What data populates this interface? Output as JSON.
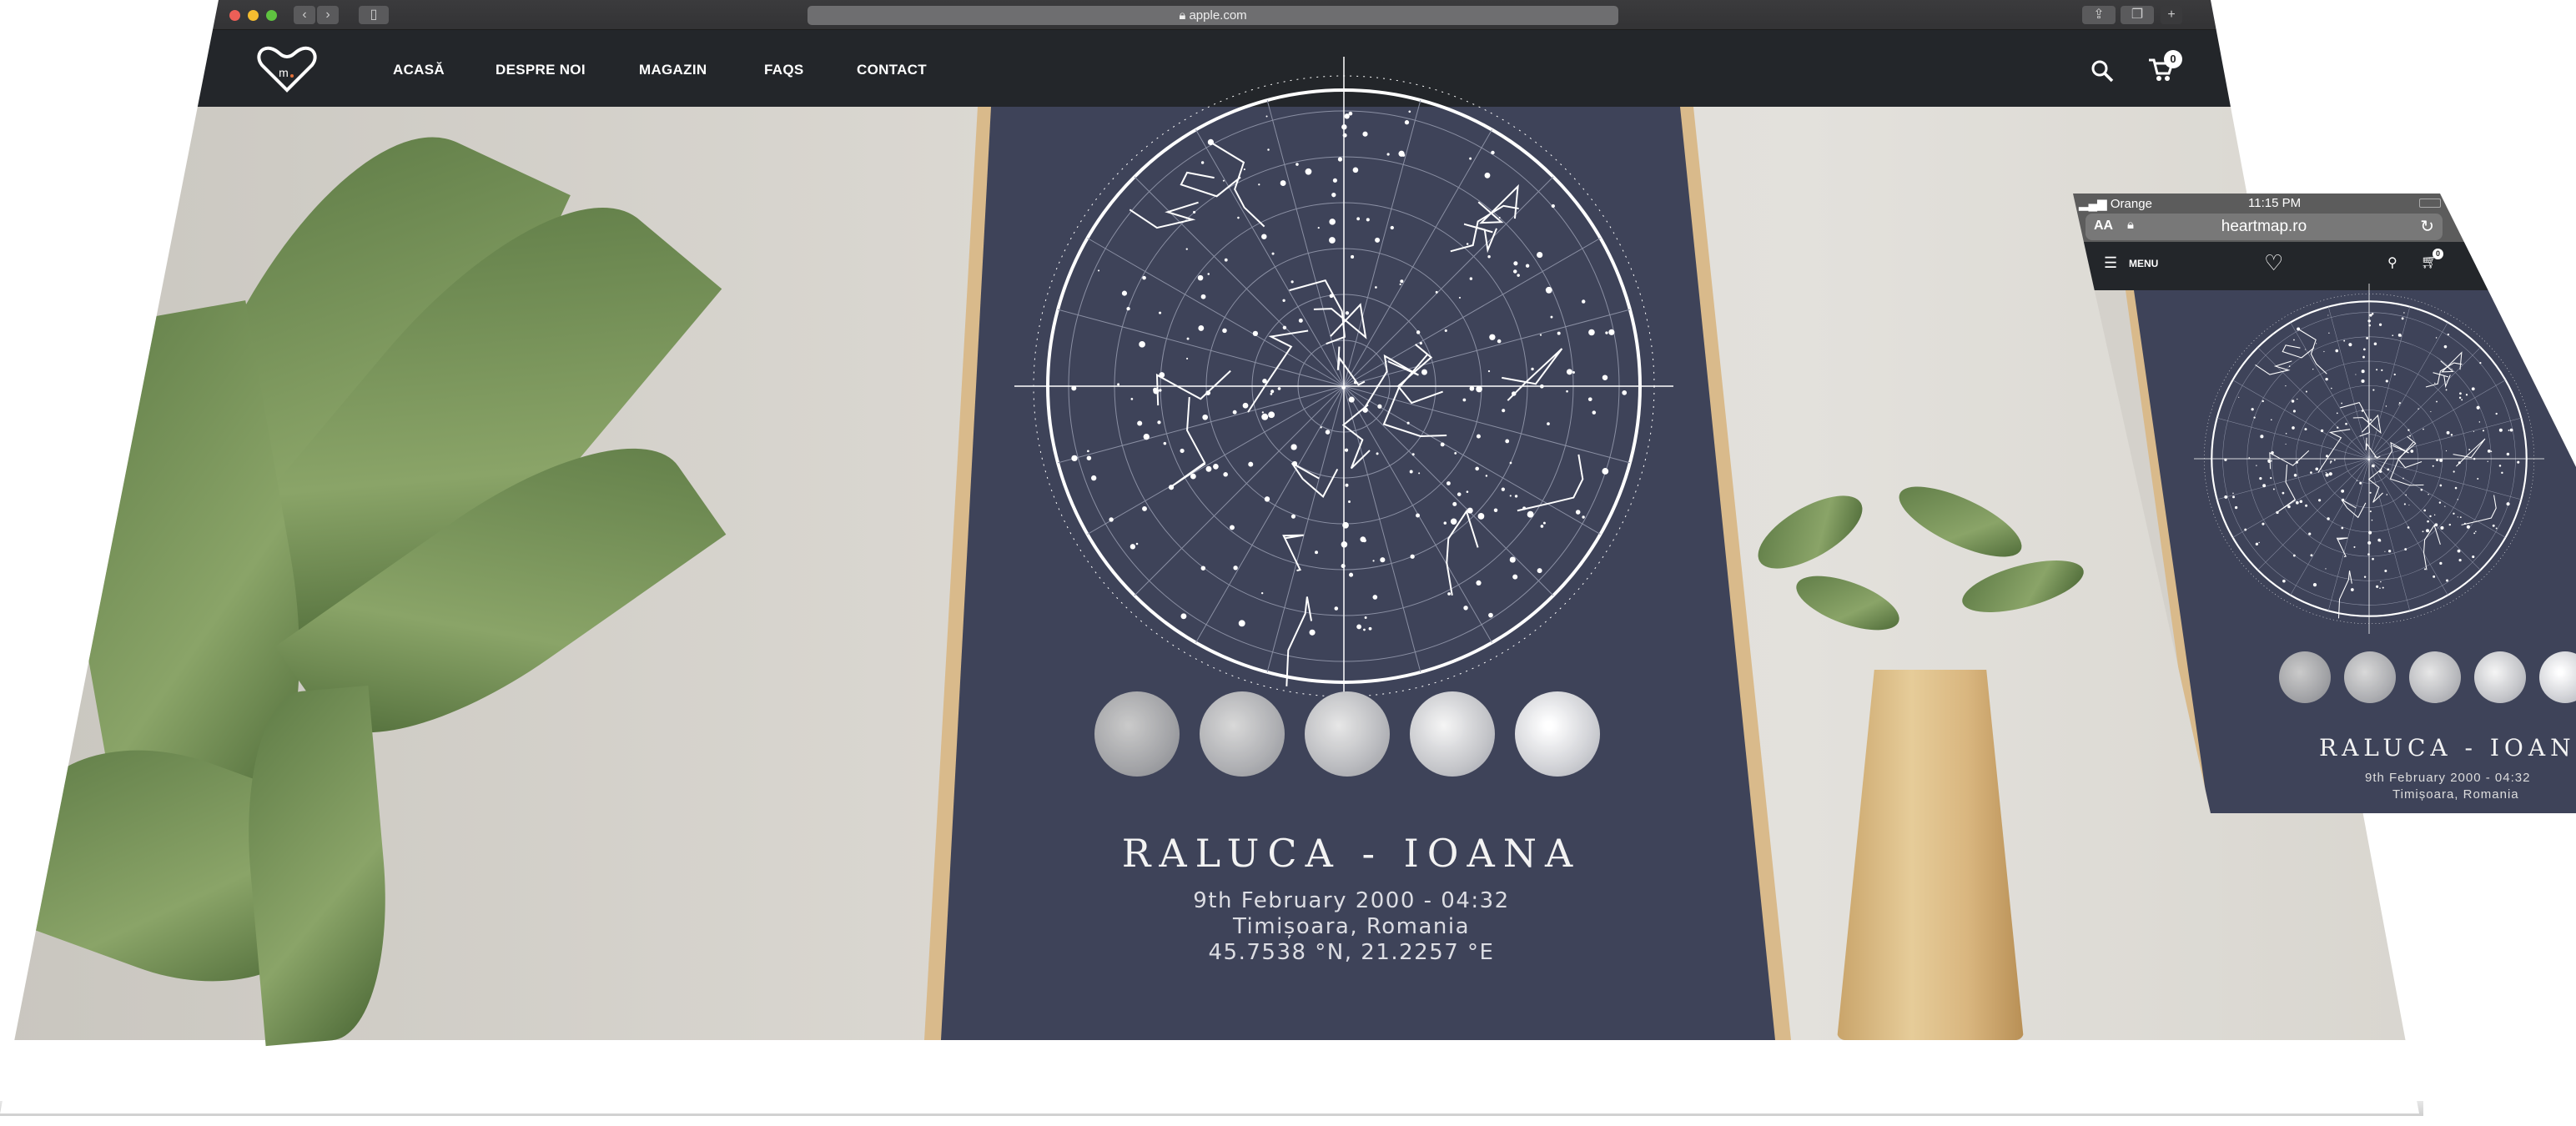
{
  "browser": {
    "url": "apple.com",
    "buttons": {
      "back": "‹",
      "forward": "›",
      "new_tab": "+"
    }
  },
  "site": {
    "logo_letter": "m",
    "nav": [
      {
        "label": "ACASĂ"
      },
      {
        "label": "DESPRE NOI"
      },
      {
        "label": "MAGAZIN"
      },
      {
        "label": "FAQS"
      },
      {
        "label": "CONTACT"
      }
    ],
    "cart_count": "0"
  },
  "poster": {
    "title": "RALUCA - IOANA",
    "date": "9th February 2000 - 04:32",
    "place": "Timișoara, Romania",
    "coords": "45.7538 °N, 21.2257 °E",
    "moon_phases": 5
  },
  "phone": {
    "carrier": "Orange",
    "time": "11:15 PM",
    "text_size": "AA",
    "url": "heartmap.ro",
    "menu_label": "MENU",
    "cart_count": "0",
    "poster_title": "RALUCA - IOAN",
    "poster_date": "9th February 2000 - 04:32",
    "poster_place": "Timișoara, Romania"
  },
  "colors": {
    "nav_bg": "#23262a",
    "poster_bg": "#3e4359",
    "frame": "#d9ba8b"
  }
}
